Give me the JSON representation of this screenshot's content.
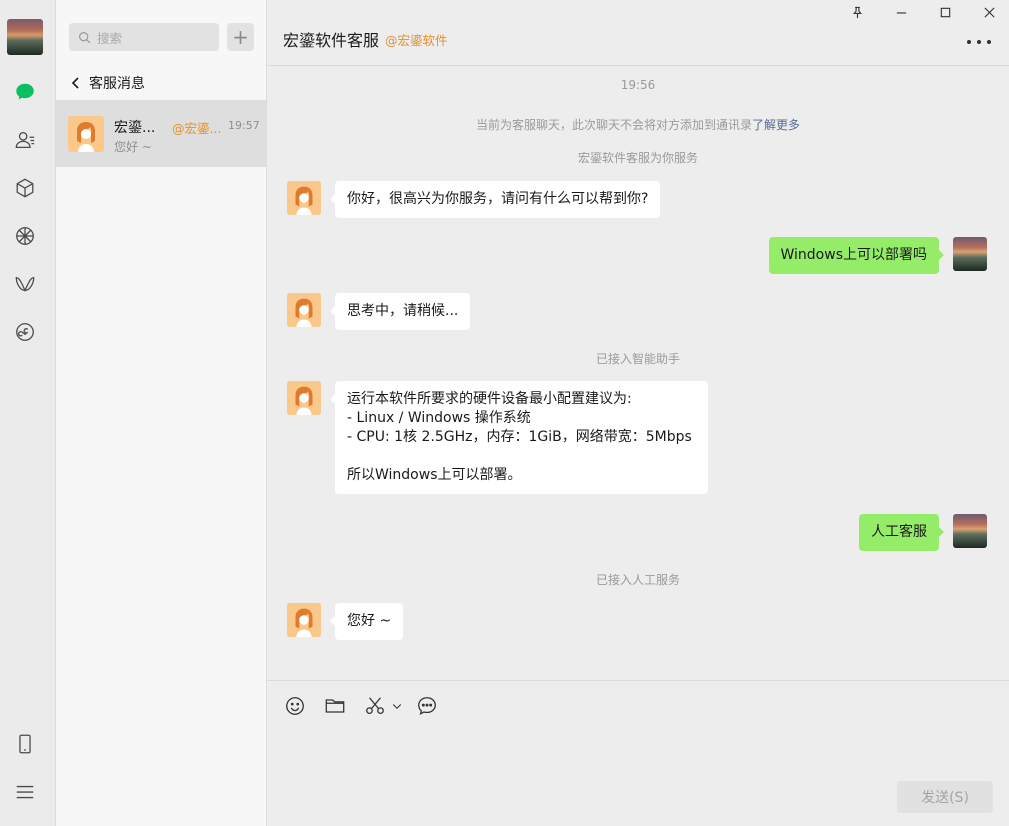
{
  "rail": {
    "items": [
      "chat-icon",
      "contacts-icon",
      "favorites-icon",
      "moments-icon",
      "channels-icon",
      "mini-programs-icon"
    ],
    "bottom": [
      "phone-icon",
      "menu-icon"
    ],
    "active_color": "#07c160"
  },
  "list": {
    "search_placeholder": "搜索",
    "add_label": "+",
    "back_label": "客服消息",
    "conversations": [
      {
        "name": "宏鎏...",
        "org": "@宏鎏...",
        "time": "19:57",
        "preview": "您好 ~"
      }
    ]
  },
  "chat": {
    "title": "宏鎏软件客服",
    "org_tag": "@宏鎏软件",
    "window_controls": [
      "pin-icon",
      "minimize-icon",
      "maximize-icon",
      "close-icon"
    ],
    "time_label": "19:56",
    "notice_prefix": "当前为客服聊天，此次聊天不会将对方添加到通讯录",
    "notice_link": "了解更多",
    "service_notice": "宏鎏软件客服为你服务",
    "system_ai": "已接入智能助手",
    "system_human": "已接入人工服务",
    "messages": [
      {
        "side": "left",
        "lines": [
          "你好，很高兴为你服务，请问有什么可以帮到你?"
        ]
      },
      {
        "side": "right",
        "lines": [
          "Windows上可以部署吗"
        ]
      },
      {
        "side": "left",
        "lines": [
          "思考中，请稍候..."
        ]
      },
      {
        "side": "left",
        "lines": [
          "运行本软件所要求的硬件设备最小配置建议为:",
          "- Linux / Windows 操作系统",
          "- CPU:  1核 2.5GHz，内存：1GiB，网络带宽：5Mbps",
          "",
          "所以Windows上可以部署。"
        ]
      },
      {
        "side": "right",
        "lines": [
          "人工客服"
        ]
      },
      {
        "side": "left",
        "lines": [
          "您好 ~"
        ]
      }
    ]
  },
  "input": {
    "tools": [
      "emoji-icon",
      "folder-icon",
      "scissors-icon",
      "chat-history-icon"
    ],
    "send_label": "发送(S)"
  },
  "colors": {
    "accent_green": "#95ec69",
    "org_orange": "#e6902a",
    "link_blue": "#576b95"
  }
}
